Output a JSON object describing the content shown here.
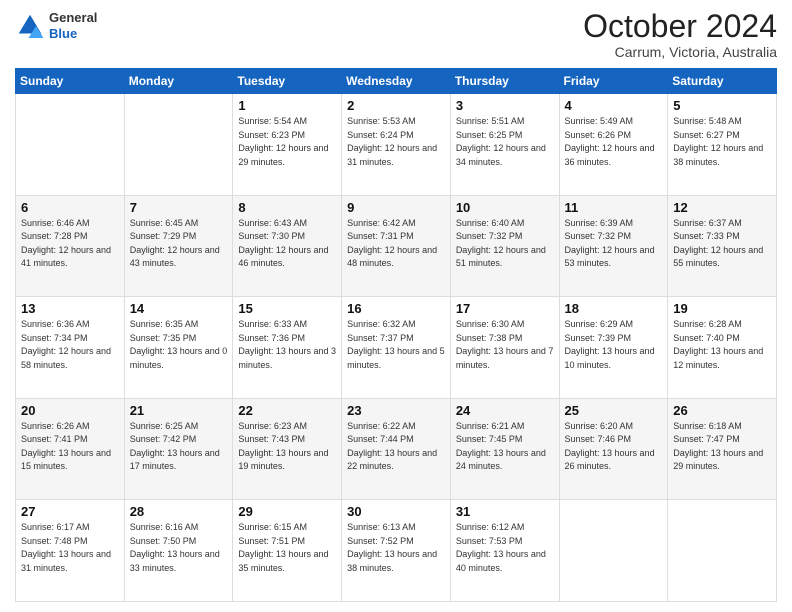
{
  "header": {
    "logo": {
      "line1": "General",
      "line2": "Blue"
    },
    "title": "October 2024",
    "location": "Carrum, Victoria, Australia"
  },
  "weekdays": [
    "Sunday",
    "Monday",
    "Tuesday",
    "Wednesday",
    "Thursday",
    "Friday",
    "Saturday"
  ],
  "weeks": [
    [
      {
        "day": null
      },
      {
        "day": null
      },
      {
        "day": "1",
        "sunrise": "Sunrise: 5:54 AM",
        "sunset": "Sunset: 6:23 PM",
        "daylight": "Daylight: 12 hours and 29 minutes."
      },
      {
        "day": "2",
        "sunrise": "Sunrise: 5:53 AM",
        "sunset": "Sunset: 6:24 PM",
        "daylight": "Daylight: 12 hours and 31 minutes."
      },
      {
        "day": "3",
        "sunrise": "Sunrise: 5:51 AM",
        "sunset": "Sunset: 6:25 PM",
        "daylight": "Daylight: 12 hours and 34 minutes."
      },
      {
        "day": "4",
        "sunrise": "Sunrise: 5:49 AM",
        "sunset": "Sunset: 6:26 PM",
        "daylight": "Daylight: 12 hours and 36 minutes."
      },
      {
        "day": "5",
        "sunrise": "Sunrise: 5:48 AM",
        "sunset": "Sunset: 6:27 PM",
        "daylight": "Daylight: 12 hours and 38 minutes."
      }
    ],
    [
      {
        "day": "6",
        "sunrise": "Sunrise: 6:46 AM",
        "sunset": "Sunset: 7:28 PM",
        "daylight": "Daylight: 12 hours and 41 minutes."
      },
      {
        "day": "7",
        "sunrise": "Sunrise: 6:45 AM",
        "sunset": "Sunset: 7:29 PM",
        "daylight": "Daylight: 12 hours and 43 minutes."
      },
      {
        "day": "8",
        "sunrise": "Sunrise: 6:43 AM",
        "sunset": "Sunset: 7:30 PM",
        "daylight": "Daylight: 12 hours and 46 minutes."
      },
      {
        "day": "9",
        "sunrise": "Sunrise: 6:42 AM",
        "sunset": "Sunset: 7:31 PM",
        "daylight": "Daylight: 12 hours and 48 minutes."
      },
      {
        "day": "10",
        "sunrise": "Sunrise: 6:40 AM",
        "sunset": "Sunset: 7:32 PM",
        "daylight": "Daylight: 12 hours and 51 minutes."
      },
      {
        "day": "11",
        "sunrise": "Sunrise: 6:39 AM",
        "sunset": "Sunset: 7:32 PM",
        "daylight": "Daylight: 12 hours and 53 minutes."
      },
      {
        "day": "12",
        "sunrise": "Sunrise: 6:37 AM",
        "sunset": "Sunset: 7:33 PM",
        "daylight": "Daylight: 12 hours and 55 minutes."
      }
    ],
    [
      {
        "day": "13",
        "sunrise": "Sunrise: 6:36 AM",
        "sunset": "Sunset: 7:34 PM",
        "daylight": "Daylight: 12 hours and 58 minutes."
      },
      {
        "day": "14",
        "sunrise": "Sunrise: 6:35 AM",
        "sunset": "Sunset: 7:35 PM",
        "daylight": "Daylight: 13 hours and 0 minutes."
      },
      {
        "day": "15",
        "sunrise": "Sunrise: 6:33 AM",
        "sunset": "Sunset: 7:36 PM",
        "daylight": "Daylight: 13 hours and 3 minutes."
      },
      {
        "day": "16",
        "sunrise": "Sunrise: 6:32 AM",
        "sunset": "Sunset: 7:37 PM",
        "daylight": "Daylight: 13 hours and 5 minutes."
      },
      {
        "day": "17",
        "sunrise": "Sunrise: 6:30 AM",
        "sunset": "Sunset: 7:38 PM",
        "daylight": "Daylight: 13 hours and 7 minutes."
      },
      {
        "day": "18",
        "sunrise": "Sunrise: 6:29 AM",
        "sunset": "Sunset: 7:39 PM",
        "daylight": "Daylight: 13 hours and 10 minutes."
      },
      {
        "day": "19",
        "sunrise": "Sunrise: 6:28 AM",
        "sunset": "Sunset: 7:40 PM",
        "daylight": "Daylight: 13 hours and 12 minutes."
      }
    ],
    [
      {
        "day": "20",
        "sunrise": "Sunrise: 6:26 AM",
        "sunset": "Sunset: 7:41 PM",
        "daylight": "Daylight: 13 hours and 15 minutes."
      },
      {
        "day": "21",
        "sunrise": "Sunrise: 6:25 AM",
        "sunset": "Sunset: 7:42 PM",
        "daylight": "Daylight: 13 hours and 17 minutes."
      },
      {
        "day": "22",
        "sunrise": "Sunrise: 6:23 AM",
        "sunset": "Sunset: 7:43 PM",
        "daylight": "Daylight: 13 hours and 19 minutes."
      },
      {
        "day": "23",
        "sunrise": "Sunrise: 6:22 AM",
        "sunset": "Sunset: 7:44 PM",
        "daylight": "Daylight: 13 hours and 22 minutes."
      },
      {
        "day": "24",
        "sunrise": "Sunrise: 6:21 AM",
        "sunset": "Sunset: 7:45 PM",
        "daylight": "Daylight: 13 hours and 24 minutes."
      },
      {
        "day": "25",
        "sunrise": "Sunrise: 6:20 AM",
        "sunset": "Sunset: 7:46 PM",
        "daylight": "Daylight: 13 hours and 26 minutes."
      },
      {
        "day": "26",
        "sunrise": "Sunrise: 6:18 AM",
        "sunset": "Sunset: 7:47 PM",
        "daylight": "Daylight: 13 hours and 29 minutes."
      }
    ],
    [
      {
        "day": "27",
        "sunrise": "Sunrise: 6:17 AM",
        "sunset": "Sunset: 7:48 PM",
        "daylight": "Daylight: 13 hours and 31 minutes."
      },
      {
        "day": "28",
        "sunrise": "Sunrise: 6:16 AM",
        "sunset": "Sunset: 7:50 PM",
        "daylight": "Daylight: 13 hours and 33 minutes."
      },
      {
        "day": "29",
        "sunrise": "Sunrise: 6:15 AM",
        "sunset": "Sunset: 7:51 PM",
        "daylight": "Daylight: 13 hours and 35 minutes."
      },
      {
        "day": "30",
        "sunrise": "Sunrise: 6:13 AM",
        "sunset": "Sunset: 7:52 PM",
        "daylight": "Daylight: 13 hours and 38 minutes."
      },
      {
        "day": "31",
        "sunrise": "Sunrise: 6:12 AM",
        "sunset": "Sunset: 7:53 PM",
        "daylight": "Daylight: 13 hours and 40 minutes."
      },
      {
        "day": null
      },
      {
        "day": null
      }
    ]
  ]
}
